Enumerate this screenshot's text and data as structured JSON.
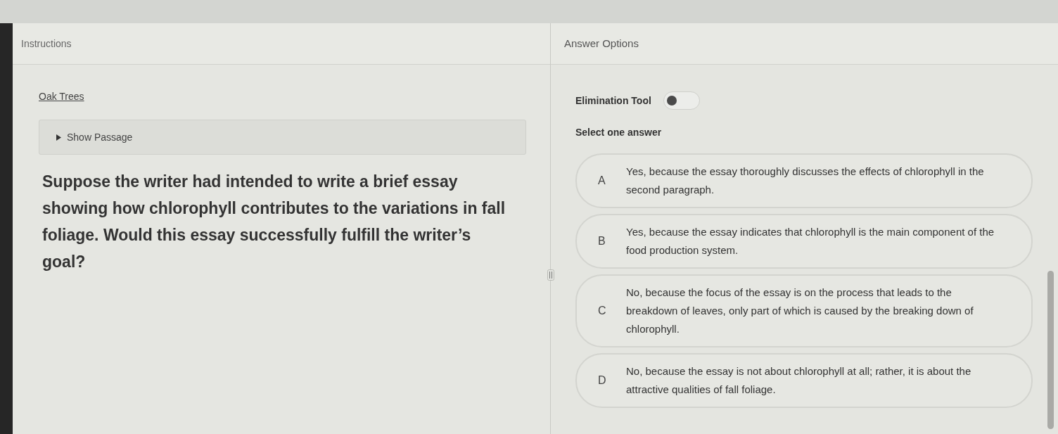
{
  "instructions_panel": {
    "title": "Instructions",
    "passage_link": "Oak Trees",
    "passage_toggle": {
      "label": "Show Passage",
      "expanded": false
    },
    "question": "Suppose the writer had intended to write a brief essay showing how chlorophyll contributes to the variations in fall foliage. Would this essay successfully fulfill the writer’s goal?"
  },
  "answer_panel": {
    "title": "Answer Options",
    "elimination_tool": {
      "label": "Elimination Tool",
      "on": false
    },
    "prompt": "Select one answer",
    "options": [
      {
        "letter": "A",
        "text": "Yes, because the essay thoroughly discusses the effects of chlorophyll in the second paragraph.",
        "selected": false
      },
      {
        "letter": "B",
        "text": "Yes, because the essay indicates that chlorophyll is the main component of the food production system.",
        "selected": false
      },
      {
        "letter": "C",
        "text": "No, because the focus of the essay is on the process that leads to the breakdown of leaves, only part of which is caused by the breaking down of chlorophyll.",
        "selected": false
      },
      {
        "letter": "D",
        "text": "No, because the essay is not about chlorophyll at all; rather, it is about the attractive qualities of fall foliage.",
        "selected": false
      }
    ]
  }
}
